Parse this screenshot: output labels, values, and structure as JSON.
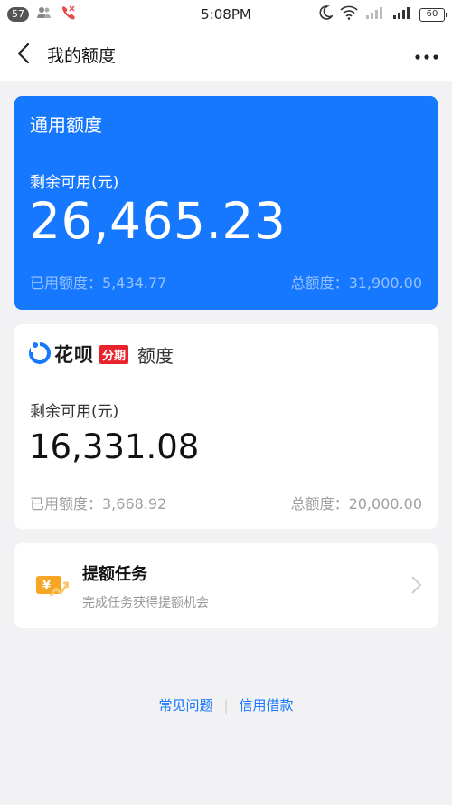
{
  "status_bar": {
    "badge": "57",
    "time": "5:08PM",
    "battery": "60"
  },
  "nav": {
    "title": "我的额度"
  },
  "general_credit": {
    "title": "通用额度",
    "label": "剩余可用(元)",
    "amount": "26,465.23",
    "used": "已用额度：5,434.77",
    "total": "总额度：31,900.00"
  },
  "huabei": {
    "brand": "花呗",
    "tag": "分期",
    "suffix": "额度",
    "label": "剩余可用(元)",
    "amount": "16,331.08",
    "used": "已用额度：3,668.92",
    "total": "总额度：20,000.00"
  },
  "task": {
    "title": "提额任务",
    "subtitle": "完成任务获得提额机会"
  },
  "footer": {
    "link1": "常见问题",
    "link2": "信用借款"
  },
  "colors": {
    "accent": "#1677ff",
    "tag_red": "#e8232b",
    "icon_orange": "#f6a623"
  },
  "icons": [
    "back-arrow-icon",
    "more-icon",
    "huabei-logo-icon",
    "task-coin-icon",
    "chevron-right-icon",
    "wifi-icon",
    "moon-icon",
    "signal-icon",
    "battery-icon",
    "contacts-icon",
    "missed-call-icon"
  ]
}
